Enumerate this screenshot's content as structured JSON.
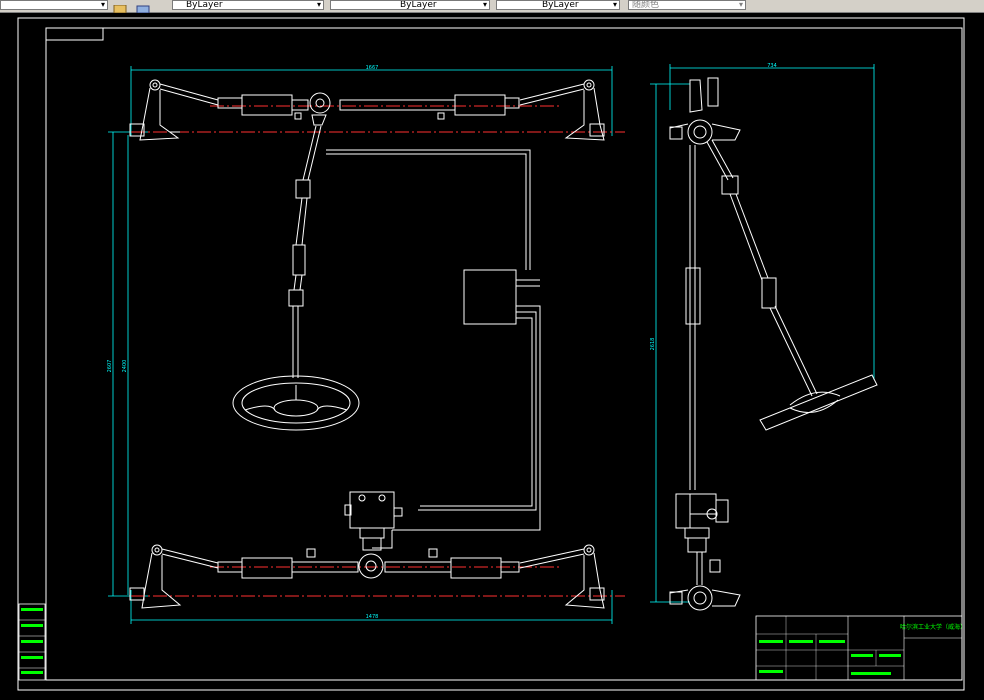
{
  "toolbar": {
    "color_control": "ByLayer",
    "linetype_control": "ByLayer",
    "lineweight_control": "ByLayer",
    "plot_style_control": "随颜色",
    "icons": [
      "layer-state-icon",
      "layer-stack-icon"
    ]
  },
  "drawing": {
    "top_width_dim": "1667",
    "side_width_dim": "734",
    "bottom_width_dim": "1478",
    "left_height_dim_outer": "2607",
    "left_height_dim_inner": "2400",
    "side_height_dim": "2618",
    "title_block": {
      "school": "哈尔滨工业大学（威海）"
    }
  },
  "colors": {
    "cad_background": "#000000",
    "dimension": "#00ffff",
    "centerline": "#ff3030",
    "outline": "#ffffff",
    "title_text": "#00ff00"
  }
}
